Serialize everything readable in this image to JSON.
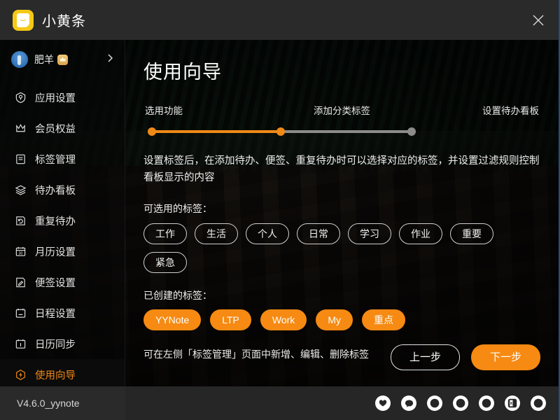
{
  "window": {
    "app_title": "小黄条",
    "logo_icon": "yellow-note-logo",
    "close_icon": "close-icon",
    "accent_color": "#f68a12",
    "border_color": "#2a4a7a"
  },
  "sidebar": {
    "user": {
      "name": "肥羊",
      "avatar_icon": "avatar",
      "vip_badge_icon": "crown-badge-icon",
      "chevron_icon": "chevron-right-icon"
    },
    "items": [
      {
        "label": "应用设置",
        "icon": "shield-settings-icon",
        "active": false
      },
      {
        "label": "会员权益",
        "icon": "crown-icon",
        "active": false
      },
      {
        "label": "标签管理",
        "icon": "tag-list-icon",
        "active": false
      },
      {
        "label": "待办看板",
        "icon": "layers-icon",
        "active": false
      },
      {
        "label": "重复待办",
        "icon": "repeat-task-icon",
        "active": false
      },
      {
        "label": "月历设置",
        "icon": "calendar-30-icon",
        "active": false
      },
      {
        "label": "便签设置",
        "icon": "note-edit-icon",
        "active": false
      },
      {
        "label": "日程设置",
        "icon": "calendar-minus-icon",
        "active": false
      },
      {
        "label": "日历同步",
        "icon": "calendar-sync-icon",
        "active": false
      },
      {
        "label": "使用向导",
        "icon": "lightning-hex-icon",
        "active": true
      }
    ],
    "version": "V4.6.0_yynote"
  },
  "main": {
    "page_title": "使用向导",
    "steps": {
      "labels": [
        "选用功能",
        "添加分类标签",
        "设置待办看板"
      ],
      "current_index": 1,
      "completed_color": "#ef8a17",
      "pending_color": "#8c8c8c"
    },
    "description": "设置标签后，在添加待办、便签、重复待办时可以选择对应的标签，并设置过滤规则控制看板显示的内容",
    "selectable_label": "可选用的标签：",
    "selectable_tags": [
      "工作",
      "生活",
      "个人",
      "日常",
      "学习",
      "作业",
      "重要",
      "紧急"
    ],
    "created_label": "已创建的标签：",
    "created_tags": [
      "YYNote",
      "LTP",
      "Work",
      "My",
      "重点"
    ],
    "hint": "可在左侧「标签管理」页面中新增、编辑、删除标签",
    "prev_button": "上一步",
    "next_button": "下一步"
  },
  "bottombar": {
    "icons": [
      "heart-icon",
      "chat-bubble-icon",
      "question-mark-icon",
      "share-arrow-icon",
      "refresh-icon",
      "excel-export-icon",
      "home-icon"
    ]
  }
}
